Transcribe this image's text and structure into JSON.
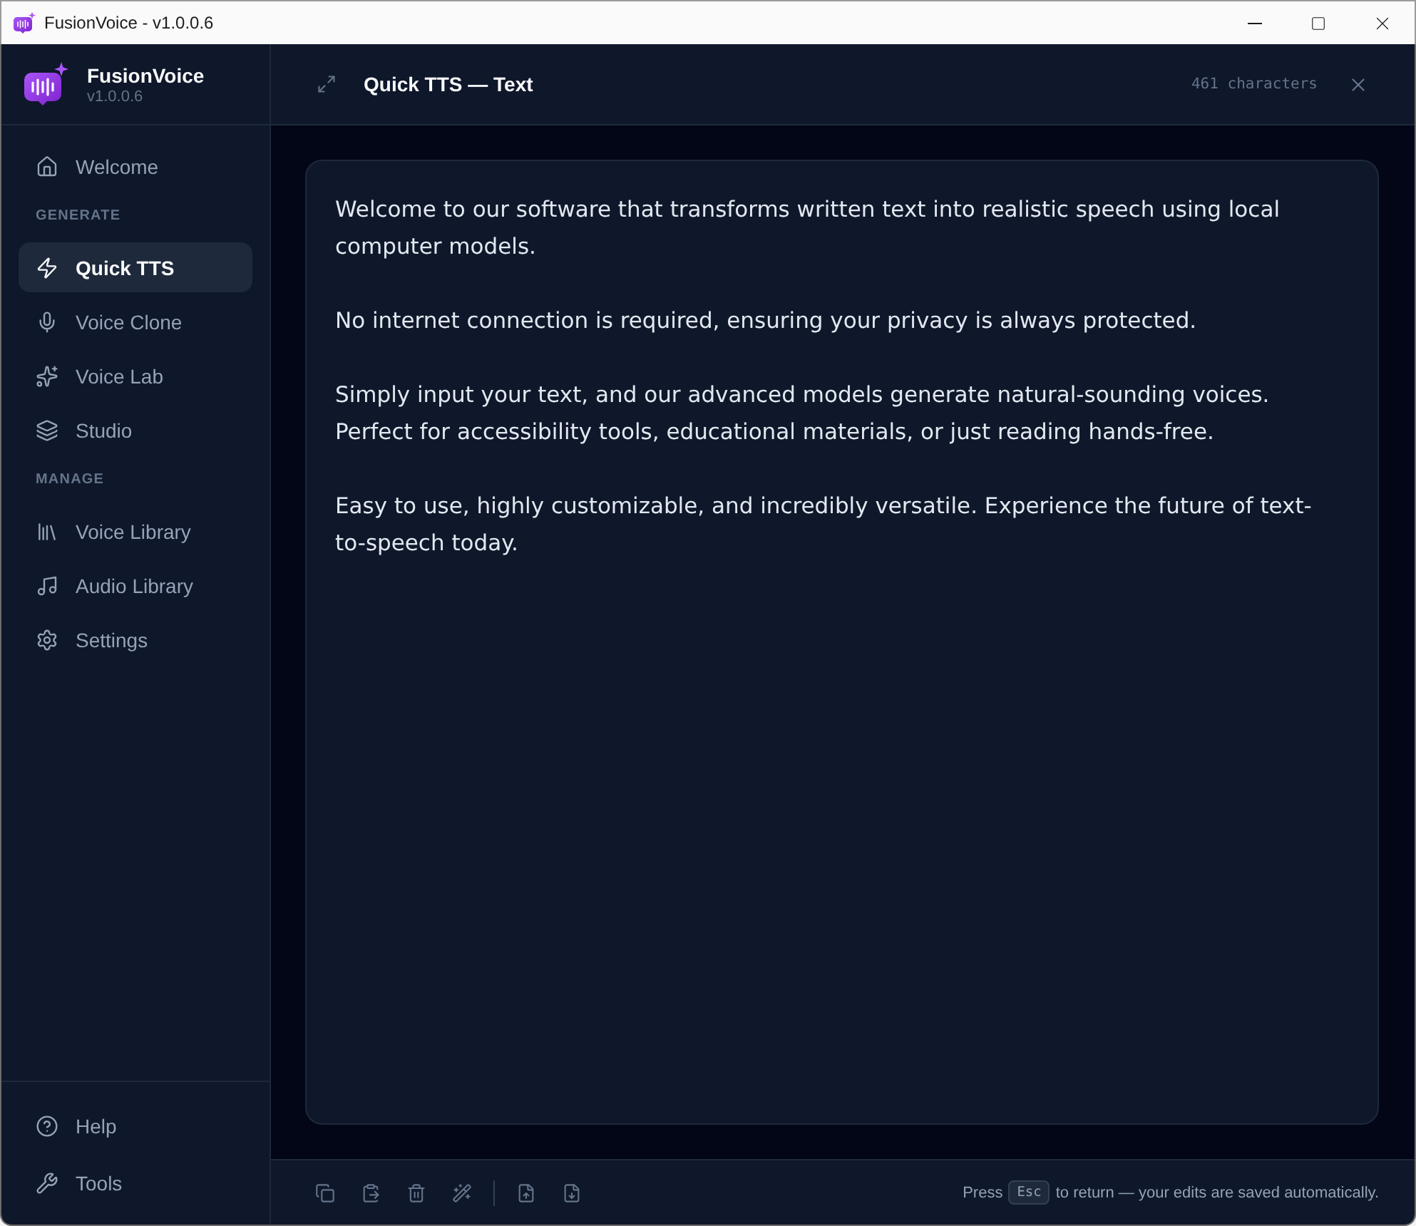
{
  "window": {
    "title": "FusionVoice - v1.0.0.6"
  },
  "sidebar": {
    "app_name": "FusionVoice",
    "version": "v1.0.0.6",
    "groups": [
      {
        "items": [
          {
            "label": "Welcome",
            "selected": false
          }
        ]
      },
      {
        "heading": "GENERATE",
        "items": [
          {
            "label": "Quick TTS",
            "selected": true
          },
          {
            "label": "Voice Clone",
            "selected": false
          },
          {
            "label": "Voice Lab",
            "selected": false
          },
          {
            "label": "Studio",
            "selected": false
          }
        ]
      },
      {
        "heading": "MANAGE",
        "items": [
          {
            "label": "Voice Library",
            "selected": false
          },
          {
            "label": "Audio Library",
            "selected": false
          },
          {
            "label": "Settings",
            "selected": false
          }
        ]
      }
    ],
    "bottom_items": [
      {
        "label": "Help"
      },
      {
        "label": "Tools"
      }
    ]
  },
  "editor": {
    "title": "Quick TTS — Text",
    "character_count": "461 characters",
    "paragraphs": [
      "Welcome to our software that transforms written text into realistic speech using local computer models.",
      "No internet connection is required, ensuring your privacy is always protected.",
      "Simply input your text, and our advanced models generate natural-sounding voices. Perfect for accessibility tools, educational materials, or just reading hands-free.",
      "Easy to use, highly customizable, and incredibly versatile. Experience the future of text-to-speech today."
    ]
  },
  "footer": {
    "hint_before": "Press",
    "key": "Esc",
    "hint_after": "to return — your edits are saved automatically."
  }
}
